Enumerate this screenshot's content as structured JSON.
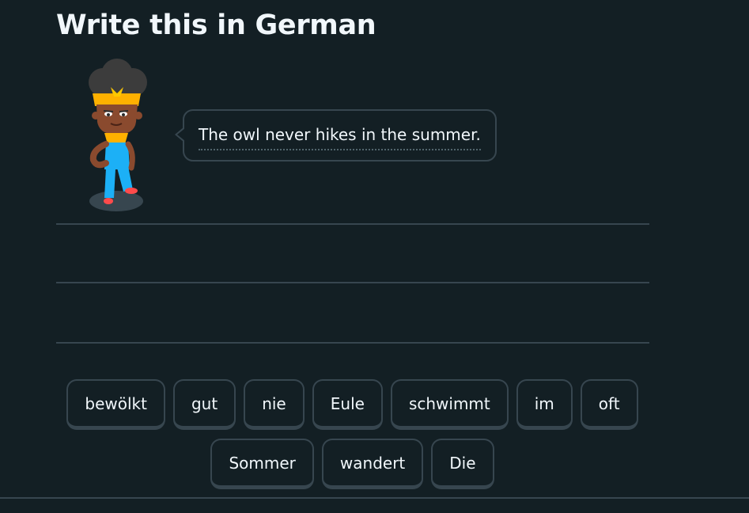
{
  "challenge": {
    "title": "Write this in German",
    "prompt": "The owl never hikes in the summer."
  },
  "word_bank": {
    "row1": [
      {
        "label": "bewölkt"
      },
      {
        "label": "gut"
      },
      {
        "label": "nie"
      },
      {
        "label": "Eule"
      },
      {
        "label": "schwimmt"
      },
      {
        "label": "im"
      },
      {
        "label": "oft"
      }
    ],
    "row2": [
      {
        "label": "Sommer"
      },
      {
        "label": "wandert"
      },
      {
        "label": "Die"
      }
    ]
  },
  "colors": {
    "background": "#131f24",
    "border": "#37464f",
    "text": "#f1f7fb"
  },
  "icons": {
    "character": "character-illustration"
  }
}
